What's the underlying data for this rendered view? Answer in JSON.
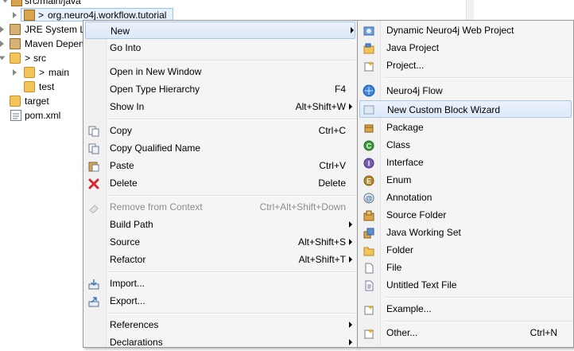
{
  "tree": {
    "items": [
      {
        "label": "src/main/java"
      },
      {
        "label": "org.neuro4j.workflow.tutorial"
      },
      {
        "label": "JRE System Library"
      },
      {
        "label": "Maven Dependencies"
      },
      {
        "label": "src"
      },
      {
        "label": "main"
      },
      {
        "label": "test"
      },
      {
        "label": "target"
      },
      {
        "label": "pom.xml"
      }
    ],
    "pkg_prefix": ">",
    "main_prefix": ">",
    "src_prefix": ">"
  },
  "context_menu": {
    "items": [
      {
        "label": "New",
        "shortcut": "",
        "submenu": true
      },
      {
        "label": "Go Into",
        "shortcut": ""
      },
      {
        "label": "Open in New Window",
        "shortcut": ""
      },
      {
        "label": "Open Type Hierarchy",
        "shortcut": "F4"
      },
      {
        "label": "Show In",
        "shortcut": "Alt+Shift+W",
        "submenu": true
      },
      {
        "label": "Copy",
        "shortcut": "Ctrl+C",
        "icon": "copy-icon"
      },
      {
        "label": "Copy Qualified Name",
        "shortcut": "",
        "icon": "copy-qualified-icon"
      },
      {
        "label": "Paste",
        "shortcut": "Ctrl+V",
        "icon": "paste-icon"
      },
      {
        "label": "Delete",
        "shortcut": "Delete",
        "icon": "delete-icon"
      },
      {
        "label": "Remove from Context",
        "shortcut": "Ctrl+Alt+Shift+Down",
        "disabled": true,
        "icon": "remove-context-icon"
      },
      {
        "label": "Build Path",
        "shortcut": "",
        "submenu": true
      },
      {
        "label": "Source",
        "shortcut": "Alt+Shift+S",
        "submenu": true
      },
      {
        "label": "Refactor",
        "shortcut": "Alt+Shift+T",
        "submenu": true
      },
      {
        "label": "Import...",
        "shortcut": "",
        "icon": "import-icon"
      },
      {
        "label": "Export...",
        "shortcut": "",
        "icon": "export-icon"
      },
      {
        "label": "References",
        "shortcut": "",
        "submenu": true
      },
      {
        "label": "Declarations",
        "shortcut": "",
        "submenu": true
      }
    ]
  },
  "new_submenu": {
    "items": [
      {
        "label": "Dynamic Neuro4j Web Project",
        "icon": "web-project-icon"
      },
      {
        "label": "Java Project",
        "icon": "java-project-icon"
      },
      {
        "label": "Project...",
        "icon": "project-icon"
      },
      {
        "label": "Neuro4j Flow",
        "icon": "neuro4j-flow-icon"
      },
      {
        "label": "New Custom Block Wizard",
        "icon": "custom-block-icon",
        "highlighted": true
      },
      {
        "label": "Package",
        "icon": "package-icon"
      },
      {
        "label": "Class",
        "icon": "class-icon"
      },
      {
        "label": "Interface",
        "icon": "interface-icon"
      },
      {
        "label": "Enum",
        "icon": "enum-icon"
      },
      {
        "label": "Annotation",
        "icon": "annotation-icon"
      },
      {
        "label": "Source Folder",
        "icon": "source-folder-icon"
      },
      {
        "label": "Java Working Set",
        "icon": "working-set-icon"
      },
      {
        "label": "Folder",
        "icon": "folder-icon"
      },
      {
        "label": "File",
        "icon": "file-icon"
      },
      {
        "label": "Untitled Text File",
        "icon": "text-file-icon"
      },
      {
        "label": "Example...",
        "icon": "example-icon"
      },
      {
        "label": "Other...",
        "icon": "other-icon",
        "shortcut": "Ctrl+N"
      }
    ]
  },
  "colors": {
    "highlight_bg": "#dde9f9",
    "highlight_border": "#a8c7ea",
    "menu_bg": "#f5f5f5",
    "disabled_text": "#8d8d8d",
    "delete_red": "#d8262a"
  }
}
